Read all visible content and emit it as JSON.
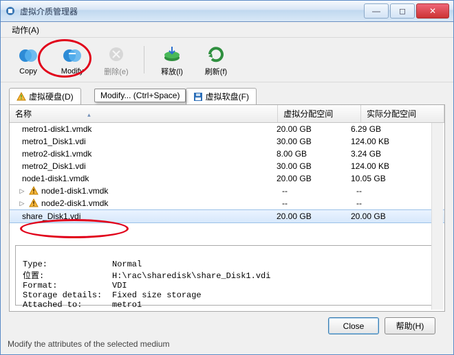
{
  "titlebar": {
    "title": "虚拟介质管理器"
  },
  "menubar": {
    "items": [
      "动作(A)"
    ]
  },
  "toolbar": {
    "copy": "Copy",
    "modify": "Modify",
    "delete": "删除(e)",
    "release": "释放(l)",
    "refresh": "刷新(f)"
  },
  "tabs": {
    "hdd": "虚拟硬盘(D)",
    "floppy": "虚拟软盘(F)"
  },
  "tooltip": "Modify... (Ctrl+Space)",
  "columns": {
    "name": "名称",
    "virtual": "虚拟分配空间",
    "actual": "实际分配空间"
  },
  "rows": [
    {
      "name": "metro1-disk1.vmdk",
      "virt": "20.00 GB",
      "act": "6.29 GB",
      "exp": false,
      "warn": false
    },
    {
      "name": "metro1_Disk1.vdi",
      "virt": "30.00 GB",
      "act": "124.00 KB",
      "exp": false,
      "warn": false
    },
    {
      "name": "metro2-disk1.vmdk",
      "virt": "8.00 GB",
      "act": "3.24 GB",
      "exp": false,
      "warn": false
    },
    {
      "name": "metro2_Disk1.vdi",
      "virt": "30.00 GB",
      "act": "124.00 KB",
      "exp": false,
      "warn": false
    },
    {
      "name": "node1-disk1.vmdk",
      "virt": "20.00 GB",
      "act": "10.05 GB",
      "exp": false,
      "warn": false
    },
    {
      "name": "node1-disk1.vmdk",
      "virt": "--",
      "act": "--",
      "exp": true,
      "warn": true
    },
    {
      "name": "node2-disk1.vmdk",
      "virt": "--",
      "act": "--",
      "exp": true,
      "warn": true
    },
    {
      "name": "share_Disk1.vdi",
      "virt": "20.00 GB",
      "act": "20.00 GB",
      "exp": false,
      "warn": false,
      "sel": true
    }
  ],
  "details": {
    "type_label": "Type:",
    "type": "Normal",
    "loc_label": "位置:",
    "loc": "H:\\rac\\sharedisk\\share_Disk1.vdi",
    "fmt_label": "Format:",
    "fmt": "VDI",
    "storage_label": "Storage details:",
    "storage": "Fixed size storage",
    "attached_label": "Attached to:",
    "attached": "metro1"
  },
  "buttons": {
    "close": "Close",
    "help": "帮助(H)"
  },
  "statusbar": "Modify the attributes of the selected medium",
  "winbtns": {
    "min": "—",
    "max": "◻",
    "close": "✕"
  }
}
